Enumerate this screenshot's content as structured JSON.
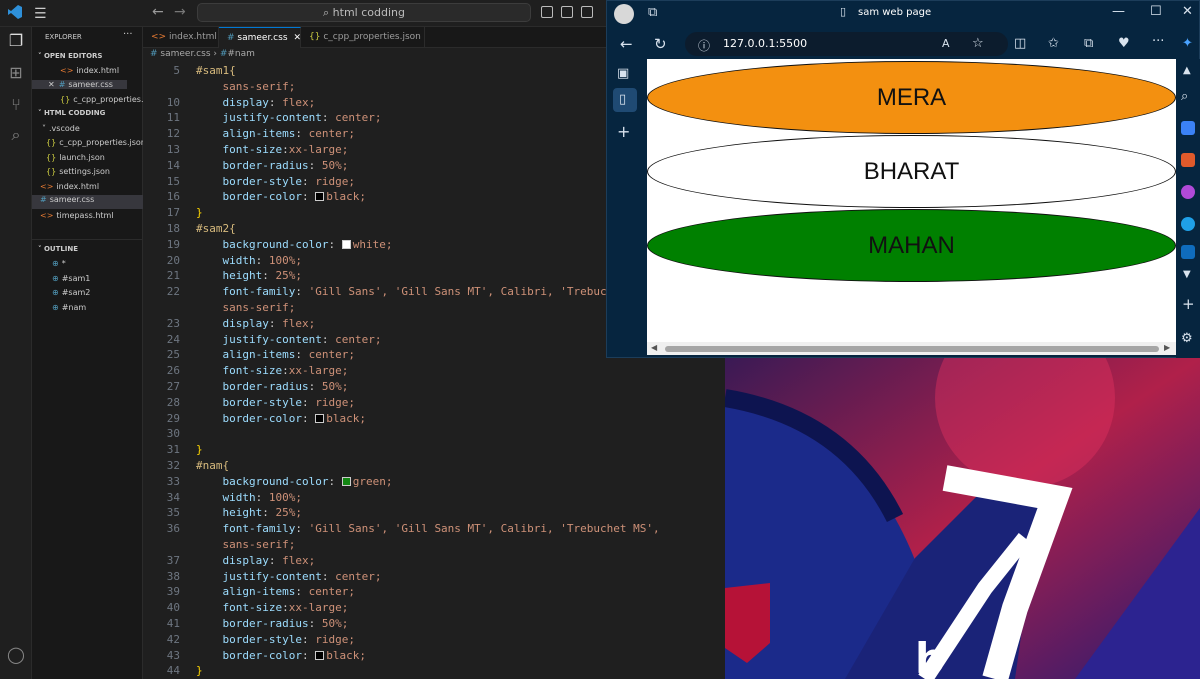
{
  "vscode": {
    "search_text": "html codding",
    "sidebar": {
      "explorer_title": "EXPLORER",
      "open_editors_title": "OPEN EDITORS",
      "open_editors": [
        {
          "name": "index.html",
          "icon": "html-icon"
        },
        {
          "name": "sameer.css",
          "icon": "css-icon"
        },
        {
          "name": "c_cpp_properties.json",
          "icon": "json-icon"
        }
      ],
      "workspace_title": "HTML CODDING",
      "files": [
        {
          "name": ".vscode",
          "icon": "folder-icon"
        },
        {
          "name": "c_cpp_properties.json",
          "icon": "json-icon"
        },
        {
          "name": "launch.json",
          "icon": "json-icon"
        },
        {
          "name": "settings.json",
          "icon": "json-icon"
        },
        {
          "name": "index.html",
          "icon": "html-icon"
        },
        {
          "name": "sameer.css",
          "icon": "css-icon"
        },
        {
          "name": "timepass.html",
          "icon": "html-icon"
        }
      ],
      "outline_title": "OUTLINE",
      "outline": [
        "*",
        "#sam1",
        "#sam2",
        "#nam"
      ]
    },
    "tabs": [
      "index.html",
      "sameer.css",
      "c_cpp_properties.json"
    ],
    "breadcrumb": [
      "sameer.css",
      "#nam"
    ],
    "code_lines": [
      {
        "n": "5",
        "t": "#sam1{"
      },
      {
        "n": "",
        "t": "    sans-serif;"
      },
      {
        "n": "10",
        "t": "    display: flex;"
      },
      {
        "n": "11",
        "t": "    justify-content: center;"
      },
      {
        "n": "12",
        "t": "    align-items: center;"
      },
      {
        "n": "13",
        "t": "    font-size:xx-large;"
      },
      {
        "n": "14",
        "t": "    border-radius: 50%;"
      },
      {
        "n": "15",
        "t": "    border-style: ridge;"
      },
      {
        "n": "16",
        "t": "    border-color: black;"
      },
      {
        "n": "17",
        "t": "}"
      },
      {
        "n": "18",
        "t": "#sam2{"
      },
      {
        "n": "19",
        "t": "    background-color: white;"
      },
      {
        "n": "20",
        "t": "    width: 100%;"
      },
      {
        "n": "21",
        "t": "    height: 25%;"
      },
      {
        "n": "22",
        "t": "    font-family: 'Gill Sans', 'Gill Sans MT', Calibri, 'Trebuchet MS',"
      },
      {
        "n": "",
        "t": "    sans-serif;"
      },
      {
        "n": "23",
        "t": "    display: flex;"
      },
      {
        "n": "24",
        "t": "    justify-content: center;"
      },
      {
        "n": "25",
        "t": "    align-items: center;"
      },
      {
        "n": "26",
        "t": "    font-size:xx-large;"
      },
      {
        "n": "27",
        "t": "    border-radius: 50%;"
      },
      {
        "n": "28",
        "t": "    border-style: ridge;"
      },
      {
        "n": "29",
        "t": "    border-color: black;"
      },
      {
        "n": "30",
        "t": ""
      },
      {
        "n": "31",
        "t": "}"
      },
      {
        "n": "32",
        "t": "#nam{"
      },
      {
        "n": "33",
        "t": "    background-color: green;"
      },
      {
        "n": "34",
        "t": "    width: 100%;"
      },
      {
        "n": "35",
        "t": "    height: 25%;"
      },
      {
        "n": "36",
        "t": "    font-family: 'Gill Sans', 'Gill Sans MT', Calibri, 'Trebuchet MS',"
      },
      {
        "n": "",
        "t": "    sans-serif;"
      },
      {
        "n": "37",
        "t": "    display: flex;"
      },
      {
        "n": "38",
        "t": "    justify-content: center;"
      },
      {
        "n": "39",
        "t": "    align-items: center;"
      },
      {
        "n": "40",
        "t": "    font-size:xx-large;"
      },
      {
        "n": "41",
        "t": "    border-radius: 50%;"
      },
      {
        "n": "42",
        "t": "    border-style: ridge;"
      },
      {
        "n": "43",
        "t": "    border-color: black;"
      },
      {
        "n": "44",
        "t": "}"
      }
    ]
  },
  "browser": {
    "tab_title": "sam web page",
    "url": "127.0.0.1:5500",
    "ovals": [
      {
        "text": "MERA",
        "color": "#f39010"
      },
      {
        "text": "BHARAT",
        "color": "#ffffff"
      },
      {
        "text": "MAHAN",
        "color": "#008000"
      }
    ]
  }
}
